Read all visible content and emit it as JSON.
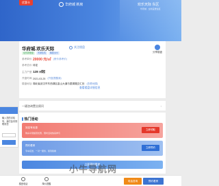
{
  "hero": {
    "badge": "优惠卡",
    "logo_text": "华府城 新房",
    "right_text": "欢乐天际 东区",
    "right_sub": "华府城 · 全新宜居住区"
  },
  "project": {
    "title": "华府城.欢乐天际",
    "follow_label": "关注楼盘",
    "share_label": "分享楼盘",
    "tags": [
      {
        "label": "在售新楼盘",
        "tone": "green"
      },
      {
        "label": "普通住宅",
        "tone": "blue"
      },
      {
        "label": "精装交付",
        "tone": "blue"
      }
    ],
    "rows": [
      {
        "key": "参考单价:",
        "value": "20000 元/㎡",
        "style": "price",
        "link": "(房价参考价)"
      },
      {
        "key": "参考总价:",
        "value": "待定",
        "style": "plain",
        "link": ""
      },
      {
        "key": "主力户型:",
        "value": "128 ㎡起",
        "style": "big",
        "link": ""
      },
      {
        "key": "开盘时间:",
        "value": "2021-03-25",
        "style": "plain",
        "link": "(开盘提醒我)"
      },
      {
        "key": "楼盘地址:",
        "value": "湖北省武汉市东西湖区金山大道与银湖路交汇处",
        "style": "plain",
        "link": "(查看地图)"
      }
    ],
    "more_label": "查看楼盘详细信息"
  },
  "notice": {
    "label": "一键咨询置业顾问",
    "chevron": "›"
  },
  "float_panel": {
    "text": "输入您的手机号，我们会尽快联系您"
  },
  "activities": {
    "header": "热门活动",
    "items": [
      {
        "name": "到店有优惠",
        "desc": "购房享受超值优惠，限时活动快来参与",
        "action": "立即领取",
        "tone": "red"
      },
      {
        "name": "预约看房",
        "desc": "专车接送，一对一服务，随到随看",
        "action": "立即预约",
        "tone": "blue"
      }
    ],
    "wide_button": "立即预约看房"
  },
  "bottom_nav": {
    "items": [
      {
        "label": "楼盘电话",
        "icon": "phone-icon"
      },
      {
        "label": "降价提醒",
        "icon": "bell-icon"
      }
    ],
    "cta_primary": "电话咨询",
    "cta_secondary": "预约看房"
  },
  "watermark": "小牛导航网",
  "colors": {
    "brand_blue": "#4b86e0",
    "price_red": "#e8402f",
    "cta_orange": "#f08a18"
  }
}
